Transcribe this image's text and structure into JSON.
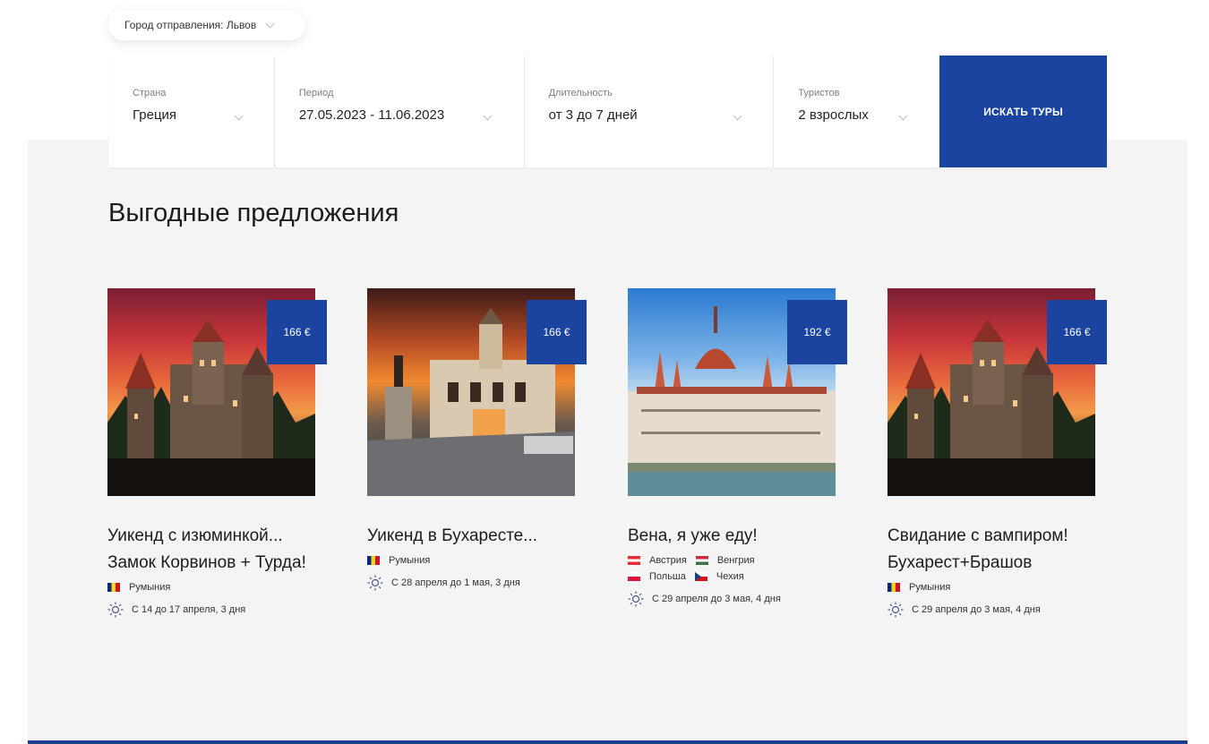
{
  "departure": {
    "label": "Город отправления: Львов"
  },
  "search": {
    "country": {
      "label": "Страна",
      "value": "Греция"
    },
    "period": {
      "label": "Период",
      "value": "27.05.2023 - 11.06.2023"
    },
    "duration": {
      "label": "Длительность",
      "value": "от 3 до 7 дней"
    },
    "tourists": {
      "label": "Туристов",
      "value": "2 взрослых"
    },
    "button_label": "ИСКАТЬ ТУРЫ"
  },
  "section": {
    "title": "Выгодные предложения"
  },
  "colors": {
    "accent": "#1b44a1",
    "background": "#f4f4f5",
    "footer_line": "#1a3c8c"
  },
  "offers": [
    {
      "price": "166 €",
      "title": "Уикенд с изюминкой... Замок Корвинов + Турда!",
      "countries": [
        {
          "name": "Румыния",
          "flag": "romania"
        }
      ],
      "dates": "С 14 до 17 апреля, 3 дня",
      "image": "castle-sunset"
    },
    {
      "price": "166 €",
      "title": "Уикенд в Бухаресте...",
      "countries": [
        {
          "name": "Румыния",
          "flag": "romania"
        }
      ],
      "dates": "С 28 апреля до 1 мая, 3 дня",
      "image": "bucharest-square"
    },
    {
      "price": "192 €",
      "title": "Вена, я уже еду!",
      "countries": [
        {
          "name": "Австрия",
          "flag": "austria"
        },
        {
          "name": "Венгрия",
          "flag": "hungary"
        },
        {
          "name": "Польша",
          "flag": "poland"
        },
        {
          "name": "Чехия",
          "flag": "czechia"
        }
      ],
      "dates": "С 29 апреля до 3 мая, 4 дня",
      "image": "budapest-parliament"
    },
    {
      "price": "166 €",
      "title": "Свидание с вампиром! Бухарест+Брашов",
      "countries": [
        {
          "name": "Румыния",
          "flag": "romania"
        }
      ],
      "dates": "С 29 апреля до 3 мая, 4 дня",
      "image": "castle-sunset"
    }
  ]
}
